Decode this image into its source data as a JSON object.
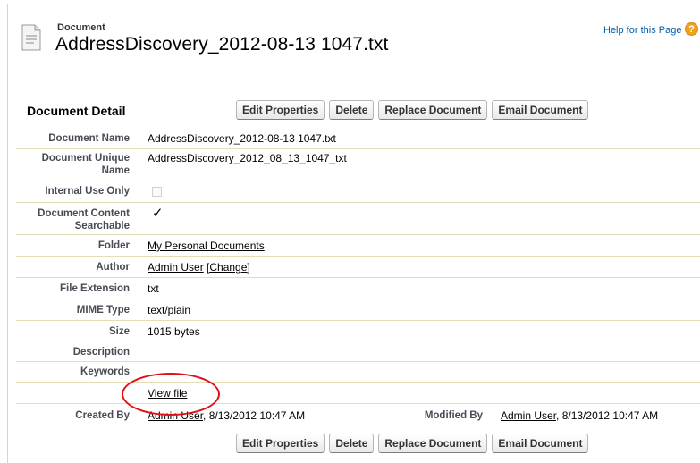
{
  "header": {
    "type_label": "Document",
    "title": "AddressDiscovery_2012-08-13 1047.txt",
    "help_link": "Help for this Page",
    "help_icon": "?"
  },
  "section": {
    "title": "Document Detail"
  },
  "buttons": {
    "edit": "Edit Properties",
    "delete": "Delete",
    "replace": "Replace Document",
    "email": "Email Document"
  },
  "fields": {
    "document_name": {
      "label": "Document Name",
      "value": "AddressDiscovery_2012-08-13 1047.txt"
    },
    "unique_name": {
      "label_1": "Document Unique",
      "label_2": "Name",
      "value": "AddressDiscovery_2012_08_13_1047_txt"
    },
    "internal_use": {
      "label": "Internal Use Only",
      "checked": false
    },
    "content_searchable": {
      "label_1": "Document Content",
      "label_2": "Searchable",
      "checked": true,
      "mark": "✓"
    },
    "folder": {
      "label": "Folder",
      "value": "My Personal Documents"
    },
    "author": {
      "label": "Author",
      "value": "Admin User",
      "change": "[Change]"
    },
    "file_extension": {
      "label": "File Extension",
      "value": "txt"
    },
    "mime_type": {
      "label": "MIME Type",
      "value": "text/plain"
    },
    "size": {
      "label": "Size",
      "value": "1015 bytes"
    },
    "description": {
      "label": "Description",
      "value": ""
    },
    "keywords": {
      "label": "Keywords",
      "value": ""
    },
    "view_file": "View file",
    "created_by": {
      "label": "Created By",
      "user": "Admin User",
      "timestamp": ", 8/13/2012 10:47 AM"
    },
    "modified_by": {
      "label": "Modified By",
      "user": "Admin User",
      "timestamp": ", 8/13/2012 10:47 AM"
    }
  },
  "colors": {
    "link": "#015ba7",
    "label": "#4a4a56",
    "row_divider": "#e3deb8",
    "annotation": "#e0101a",
    "help_icon": "#f0a21a"
  }
}
